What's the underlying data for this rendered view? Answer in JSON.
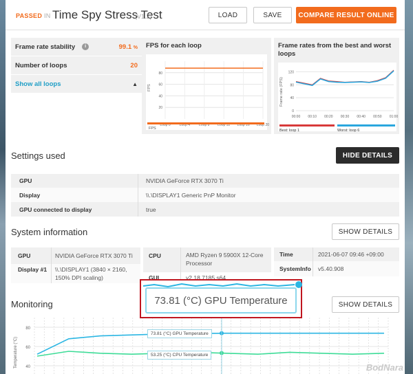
{
  "header": {
    "passed": "PASSED",
    "in": "IN",
    "title": "Time Spy Stress Test",
    "version": "(V1.2)",
    "load": "LOAD",
    "save": "SAVE",
    "compare": "COMPARE RESULT ONLINE"
  },
  "stats": {
    "stability_label": "Frame rate stability",
    "stability_value": "99.1",
    "stability_unit": "%",
    "loops_label": "Number of loops",
    "loops_value": "20",
    "show_all": "Show all loops"
  },
  "fps_chart": {
    "title": "FPS for each loop",
    "ylabel": "FPS",
    "yticks": [
      "80",
      "60",
      "40",
      "20"
    ],
    "xticks": [
      "Loop 0",
      "Loop 4",
      "Loop 8",
      "Loop 12",
      "Loop 16",
      "Loop 20"
    ],
    "legend": "FPS"
  },
  "best_worst_chart": {
    "title": "Frame rates from the best and worst loops",
    "ylabel": "Frame rate (FPS)",
    "yticks": [
      "120",
      "80",
      "40",
      "0"
    ],
    "xticks": [
      "00:00",
      "00:10",
      "00:20",
      "00:30",
      "00:40",
      "00:50",
      "01:00"
    ],
    "best_label": "Best: loop ",
    "best_num": "1",
    "worst_label": "Worst: loop ",
    "worst_num": "6"
  },
  "settings": {
    "heading": "Settings used",
    "hide_details": "HIDE DETAILS",
    "rows": [
      {
        "k": "GPU",
        "v": "NVIDIA GeForce RTX 3070 Ti"
      },
      {
        "k": "Display",
        "v": "\\\\.\\DISPLAY1 Generic PnP Monitor"
      },
      {
        "k": "GPU connected to display",
        "v": "true"
      }
    ]
  },
  "sysinfo": {
    "heading": "System information",
    "show_details": "SHOW DETAILS",
    "gpu_k": "GPU",
    "gpu_v": "NVIDIA GeForce RTX 3070 Ti",
    "disp_k": "Display #1",
    "disp_v": "\\\\.\\DISPLAY1 (3840 × 2160, 150% DPI scaling)",
    "cpu_k": "CPU",
    "cpu_v": "AMD Ryzen 9 5900X 12-Core Processor",
    "gui_k": "GUI",
    "gui_v": "v2.18.7185 s64",
    "time_k": "Time",
    "time_v": "2021-06-07 09:46 +09:00",
    "sysinfo_k": "SystemInfo",
    "sysinfo_v": "v5.40.908"
  },
  "monitoring": {
    "heading": "Monitoring",
    "show_details": "SHOW DETAILS",
    "ylabel": "Temperature (°C)",
    "yticks": [
      "80",
      "60",
      "40"
    ],
    "gpu_label": "73.81 (°C) GPU Temperature",
    "cpu_label": "53.25 (°C) CPU Temperature",
    "tooltip": "73.81 (°C) GPU Temperature"
  },
  "watermark": "BodNara",
  "colors": {
    "accent": "#f26b1d",
    "link": "#1f9ec6",
    "gpu_line": "#2bb6e3",
    "cpu_line": "#3ddc97",
    "best": "#d83a3a",
    "worst": "#2aa7de"
  },
  "chart_data": [
    {
      "type": "line",
      "title": "FPS for each loop",
      "ylabel": "FPS",
      "x": [
        0,
        4,
        8,
        12,
        16,
        20
      ],
      "series": [
        {
          "name": "FPS",
          "values": [
            88,
            88,
            88,
            88,
            88,
            88
          ]
        }
      ],
      "ylim": [
        0,
        100
      ]
    },
    {
      "type": "line",
      "title": "Frame rates from the best and worst loops",
      "ylabel": "Frame rate (FPS)",
      "xlabel": "",
      "ylim": [
        0,
        140
      ],
      "x": [
        "00:00",
        "00:05",
        "00:10",
        "00:15",
        "00:20",
        "00:25",
        "00:30",
        "00:35",
        "00:40",
        "00:45",
        "00:50",
        "00:55",
        "01:00"
      ],
      "series": [
        {
          "name": "Best: loop 1",
          "values": [
            90,
            85,
            80,
            100,
            92,
            90,
            88,
            89,
            90,
            88,
            93,
            102,
            125
          ]
        },
        {
          "name": "Worst: loop 6",
          "values": [
            88,
            83,
            78,
            98,
            90,
            88,
            87,
            88,
            89,
            87,
            91,
            100,
            123
          ]
        }
      ]
    },
    {
      "type": "line",
      "title": "Monitoring",
      "ylabel": "Temperature (°C)",
      "ylim": [
        30,
        90
      ],
      "series": [
        {
          "name": "GPU Temperature",
          "values": [
            52,
            68,
            71,
            72,
            73,
            73.5,
            73.8,
            73.8,
            73.8,
            73.8,
            73.8,
            73.8
          ]
        },
        {
          "name": "CPU Temperature",
          "values": [
            50,
            55,
            53,
            52,
            53,
            54,
            53,
            52,
            54,
            53,
            52,
            53
          ]
        }
      ]
    }
  ]
}
